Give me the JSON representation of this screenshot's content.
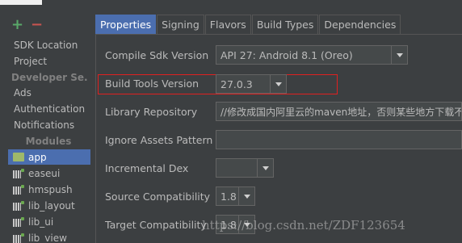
{
  "toolbar": {
    "add_label": "+",
    "remove_label": "−"
  },
  "sidebar": {
    "items": [
      "SDK Location",
      "Project"
    ],
    "developer_header": "Developer Se...",
    "dev_items": [
      "Ads",
      "Authentication",
      "Notifications"
    ],
    "modules_header": "Modules",
    "modules": [
      "app",
      "easeui",
      "hmspush",
      "lib_layout",
      "lib_ui",
      "lib_view"
    ]
  },
  "tabs": [
    "Properties",
    "Signing",
    "Flavors",
    "Build Types",
    "Dependencies"
  ],
  "form": {
    "compile_sdk": {
      "label": "Compile Sdk Version",
      "value": "API 27: Android 8.1 (Oreo)"
    },
    "build_tools": {
      "label": "Build Tools Version",
      "value": "27.0.3"
    },
    "library_repo": {
      "label": "Library Repository",
      "value": "//修改成国内阿里云的maven地址，否则某些地方下载不"
    },
    "ignore_assets": {
      "label": "Ignore Assets Pattern",
      "value": ""
    },
    "incremental_dex": {
      "label": "Incremental Dex",
      "value": ""
    },
    "source_compat": {
      "label": "Source Compatibility",
      "value": "1.8"
    },
    "target_compat": {
      "label": "Target Compatibility",
      "value": "1.8"
    }
  },
  "watermark": "https://blog.csdn.net/ZDF123654",
  "colors": {
    "accent": "#4b6eaf",
    "highlight_box": "#e02020",
    "add": "#59a869",
    "remove": "#c75450"
  }
}
